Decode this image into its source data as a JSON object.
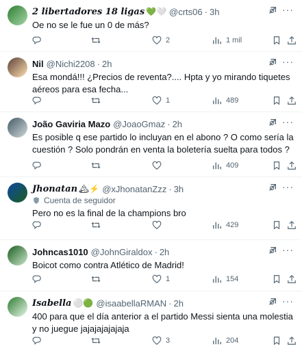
{
  "tweets": [
    {
      "name": "2 libertadores 18 ligas",
      "emoji": "💚🤍",
      "handle": "@crts06",
      "time": "3h",
      "text": "Oe no se le fue un 0 de más?",
      "replies": "",
      "retweets": "",
      "likes": "2",
      "views": "1 mil",
      "avatar_colors": [
        "#2e7d32",
        "#a5d6a7"
      ]
    },
    {
      "name": "Nil",
      "emoji": "",
      "handle": "@Nichi2208",
      "time": "2h",
      "text": "Esa mondá!!! ¿Precios de reventa?.... Hpta y yo mirando tiquetes aéreos para esa fecha...",
      "replies": "",
      "retweets": "",
      "likes": "1",
      "views": "489",
      "avatar_colors": [
        "#5d4037",
        "#ffe0b2"
      ]
    },
    {
      "name": "João Gaviria Mazo",
      "emoji": "",
      "handle": "@JoaoGmaz",
      "time": "2h",
      "text": "Es posible q ese partido lo incluyan en el abono ? O como sería la cuestión ? Solo pondrán en venta la boletería suelta para todos ?",
      "replies": "",
      "retweets": "",
      "likes": "",
      "views": "409",
      "avatar_colors": [
        "#455a64",
        "#cfd8dc"
      ]
    },
    {
      "name": "Jhonatan",
      "emoji": "🏔⚡",
      "handle": "@xJhonatanZzz",
      "time": "3h",
      "follower_label": "Cuenta de seguidor",
      "text": "Pero no es la final de la champions bro",
      "replies": "",
      "retweets": "",
      "likes": "",
      "views": "429",
      "avatar_colors": [
        "#0d47a1",
        "#1b5e20"
      ]
    },
    {
      "name": "Johncas1010",
      "emoji": "",
      "handle": "@JohnGiraldox",
      "time": "2h",
      "text": "Boicot como contra Atlético de Madrid!",
      "replies": "",
      "retweets": "",
      "likes": "1",
      "views": "154",
      "avatar_colors": [
        "#1b5e20",
        "#c8e6c9"
      ]
    },
    {
      "name": "Isabella",
      "emoji": "⚪🟢",
      "handle": "@isaabellaRMAN",
      "time": "2h",
      "text": "400 para que el día anterior a el partido Messi sienta una molestia y no juegue jajajajajajaja",
      "replies": "",
      "retweets": "",
      "likes": "3",
      "views": "204",
      "avatar_colors": [
        "#2e7d32",
        "#e8f5e9"
      ]
    }
  ],
  "more_glyph": "···",
  "dot": "·"
}
